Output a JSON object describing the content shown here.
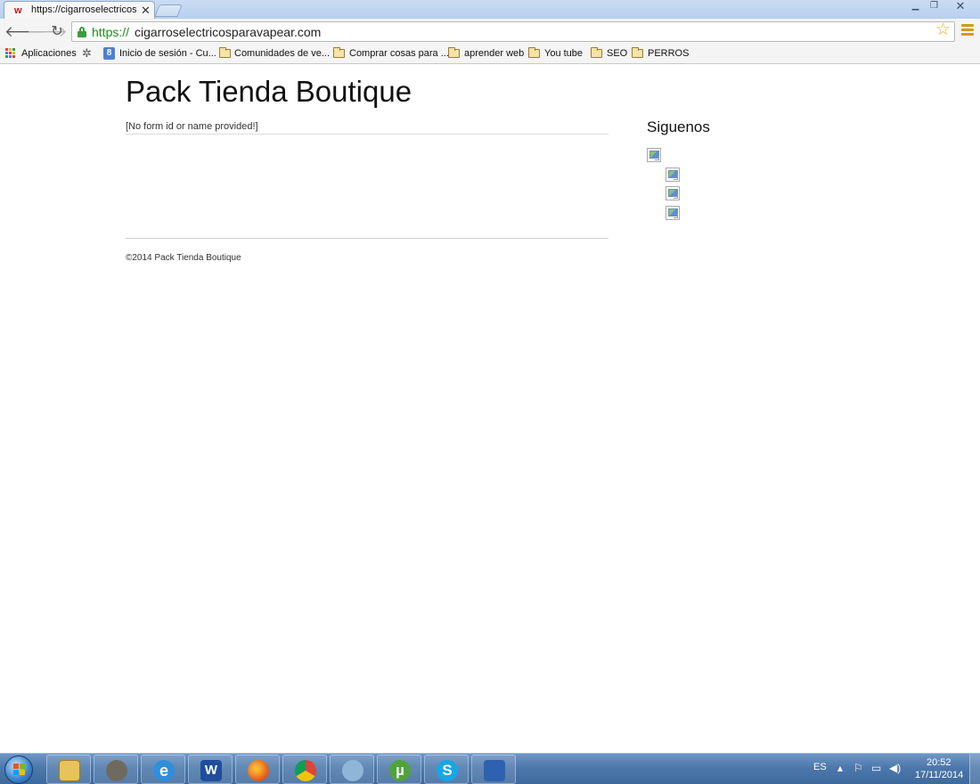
{
  "browser": {
    "tab_title": "https://cigarroselectricosp",
    "tab_favicon": "w",
    "url_protocol": "https://",
    "url_host": "cigarroselectricosparavapear.com",
    "icons": {
      "back": "back-arrow-icon",
      "forward": "forward-arrow-icon",
      "reload": "reload-icon",
      "lock": "lock-icon",
      "bookmark_star": "star-icon",
      "menu": "hamburger-menu-icon"
    },
    "colors": {
      "secure_url": "#1c8e1c",
      "star": "#e0b21b"
    }
  },
  "bookmarks": [
    {
      "label": "Aplicaciones",
      "icon": "apps-grid-icon"
    },
    {
      "label": "",
      "icon": "gear-icon"
    },
    {
      "label": "Inicio de sesión - Cu...",
      "icon": "google-icon"
    },
    {
      "label": "Comunidades de ve...",
      "icon": "folder-icon"
    },
    {
      "label": "Comprar cosas para ...",
      "icon": "folder-icon"
    },
    {
      "label": "aprender web",
      "icon": "folder-icon"
    },
    {
      "label": "You tube",
      "icon": "folder-icon"
    },
    {
      "label": "SEO",
      "icon": "folder-icon"
    },
    {
      "label": "PERROS",
      "icon": "folder-icon"
    }
  ],
  "page": {
    "site_title": "Pack Tienda Boutique",
    "form_error": "[No form id or name provided!]",
    "sidebar_heading": "Siguenos",
    "social_images": [
      "broken-image-icon",
      "broken-image-icon",
      "broken-image-icon",
      "broken-image-icon"
    ],
    "copyright": "©2014 Pack Tienda Boutique"
  },
  "taskbar": {
    "apps": [
      {
        "name": "file-explorer-icon",
        "glyph": ""
      },
      {
        "name": "gimp-icon",
        "glyph": ""
      },
      {
        "name": "internet-explorer-icon",
        "glyph": "e"
      },
      {
        "name": "word-icon",
        "glyph": "W"
      },
      {
        "name": "firefox-icon",
        "glyph": ""
      },
      {
        "name": "chrome-icon",
        "glyph": ""
      },
      {
        "name": "network-app-icon",
        "glyph": ""
      },
      {
        "name": "utorrent-icon",
        "glyph": "µ"
      },
      {
        "name": "skype-icon",
        "glyph": "S"
      },
      {
        "name": "server-app-icon",
        "glyph": ""
      }
    ],
    "tray": {
      "language": "ES",
      "time": "20:52",
      "date": "17/11/2014"
    }
  }
}
